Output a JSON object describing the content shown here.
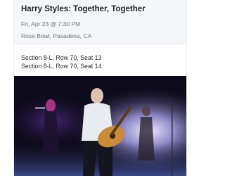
{
  "event": {
    "title": "Harry Styles: Together, Together",
    "datetime": "Fri, Apr 23 @ 7:30 PM",
    "venue": "Rose Bowl, Pasadena, CA"
  },
  "tickets": [
    {
      "label": "Section 8-L, Row 70, Seat 13"
    },
    {
      "label": "Section 8-L, Row 70, Seat 14"
    }
  ],
  "colors": {
    "header_bg": "#f4f6f9",
    "title": "#1f2328",
    "muted": "#6b7480",
    "stage_dark": "#0d0b1a",
    "stage_light": "#d9d6ff"
  }
}
